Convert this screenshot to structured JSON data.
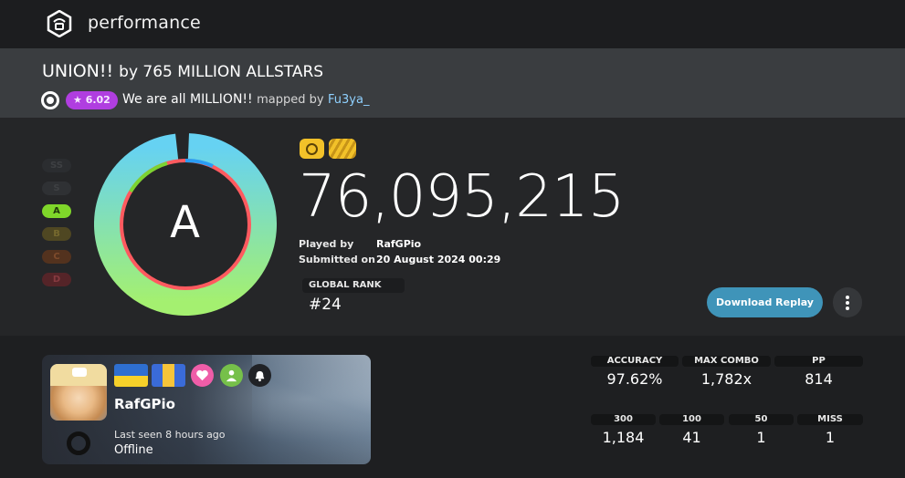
{
  "header": {
    "title": "performance",
    "logo_icon": "performance-logo-icon"
  },
  "beatmap": {
    "title": "UNION!!",
    "by_text": "by 765 MILLION ALLSTARS",
    "star_rating": "★ 6.02",
    "difficulty": "We are all MILLION!!",
    "mapped_by_label": "mapped by",
    "mapper": "Fu3ya_"
  },
  "grades": [
    "SS",
    "S",
    "A",
    "B",
    "C",
    "D"
  ],
  "play": {
    "grade": "A",
    "accuracy_fraction": 0.9762,
    "score": "76,095,215",
    "played_by_label": "Played by",
    "player": "RafGPio",
    "submitted_on_label": "Submitted on",
    "submitted_on": "20 August 2024 00:29",
    "global_rank_label": "GLOBAL RANK",
    "global_rank": "#24",
    "mods": [
      "mod-hidden-icon",
      "mod-hardrock-icon"
    ]
  },
  "actions": {
    "download_replay": "Download Replay",
    "more_icon": "more-vertical-icon"
  },
  "user": {
    "name": "RafGPio",
    "last_seen": "Last seen 8 hours ago",
    "status": "Offline",
    "icons": [
      "flag-ua-icon",
      "team-flag-icon",
      "heart-icon",
      "add-friend-icon",
      "bell-icon"
    ]
  },
  "stats": {
    "accuracy": {
      "label": "ACCURACY",
      "value": "97.62%"
    },
    "max_combo": {
      "label": "MAX COMBO",
      "value": "1,782x"
    },
    "pp": {
      "label": "PP",
      "value": "814"
    },
    "count_300": {
      "label": "300",
      "value": "1,184"
    },
    "count_100": {
      "label": "100",
      "value": "41"
    },
    "count_50": {
      "label": "50",
      "value": "1"
    },
    "miss": {
      "label": "MISS",
      "value": "1"
    }
  },
  "colors": {
    "accent_blue": "#3f94b9",
    "star_purple": "#b03ee0",
    "grade_a": "#7fd62a",
    "mod_yellow": "#f2c129",
    "ring_inner": "#ff5a5f"
  }
}
